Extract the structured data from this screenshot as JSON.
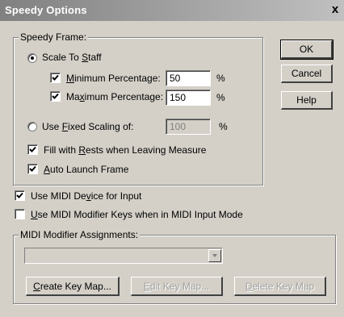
{
  "window": {
    "title": "Speedy Options",
    "close_glyph": "x"
  },
  "speedy_frame": {
    "group_label": "Speedy Frame:",
    "scale_to_staff": {
      "label_pre": "Scale To ",
      "label_ul": "S",
      "label_post": "taff",
      "selected": true
    },
    "min_pct": {
      "label_ul": "M",
      "label_post": "inimum Percentage:",
      "checked": true,
      "value": "50",
      "unit": "%"
    },
    "max_pct": {
      "label_pre": "Ma",
      "label_ul": "x",
      "label_post": "imum Percentage:",
      "checked": true,
      "value": "150",
      "unit": "%"
    },
    "fixed_scaling": {
      "label_pre": "Use ",
      "label_ul": "F",
      "label_post": "ixed Scaling of:",
      "selected": false,
      "value": "100",
      "unit": "%"
    },
    "fill_rests": {
      "label_pre": "Fill with ",
      "label_ul": "R",
      "label_post": "ests when Leaving Measure",
      "checked": true
    },
    "auto_launch": {
      "label_ul": "A",
      "label_post": "uto Launch Frame",
      "checked": true
    }
  },
  "midi": {
    "use_device": {
      "label_pre": "Use MIDI De",
      "label_ul": "v",
      "label_post": "ice for Input",
      "checked": true
    },
    "modifier_keys": {
      "label_ul": "U",
      "label_post": "se MIDI Modifier Keys when in MIDI Input Mode",
      "checked": false
    }
  },
  "modifier_assignments": {
    "group_label": "MIDI Modifier Assignments:",
    "selected_value": "",
    "create_button": {
      "label_ul": "C",
      "label_post": "reate Key Map..."
    },
    "edit_button": {
      "label_ul": "E",
      "label_post": "dit Key Map..."
    },
    "delete_button": {
      "label_ul": "D",
      "label_post": "elete Key Map"
    }
  },
  "buttons": {
    "ok": "OK",
    "cancel": "Cancel",
    "help": "Help"
  },
  "colors": {
    "face": "#d4d0c8",
    "title_gradient_start": "#808080",
    "title_gradient_end": "#c0c0c0"
  }
}
